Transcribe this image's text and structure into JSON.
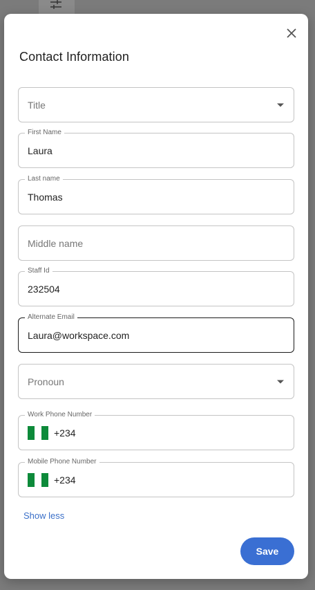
{
  "backdrop": {
    "icon": "sliders-icon"
  },
  "dialog": {
    "title": "Contact Information",
    "close_icon": "close-icon"
  },
  "fields": {
    "title": {
      "placeholder": "Title"
    },
    "first_name": {
      "label": "First Name",
      "value": "Laura"
    },
    "last_name": {
      "label": "Last name",
      "value": "Thomas"
    },
    "middle_name": {
      "placeholder": "Middle name"
    },
    "staff_id": {
      "label": "Staff Id",
      "value": "232504"
    },
    "alternate_email": {
      "label": "Alternate Email",
      "value": "Laura@workspace.com"
    },
    "pronoun": {
      "placeholder": "Pronoun"
    },
    "work_phone": {
      "label": "Work Phone Number",
      "code": "+234",
      "flag": "nigeria-flag"
    },
    "mobile_phone": {
      "label": "Mobile Phone Number",
      "code": "+234",
      "flag": "nigeria-flag"
    }
  },
  "links": {
    "show_less": "Show less"
  },
  "actions": {
    "save": "Save"
  },
  "colors": {
    "accent": "#3a6fd3",
    "link": "#3a6fc8",
    "flag_green": "#0d8a3a"
  }
}
